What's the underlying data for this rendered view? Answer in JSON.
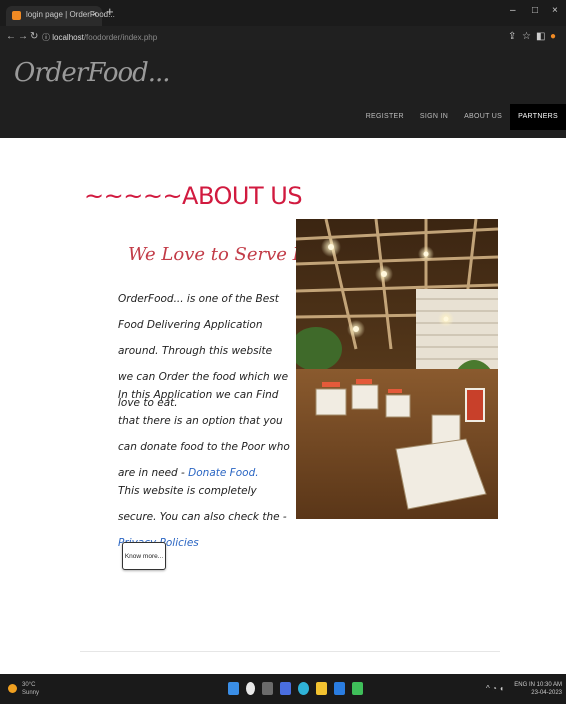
{
  "browser": {
    "tab_title": "login page | OrderFood...",
    "tab_close": "×",
    "new_tab": "+",
    "url_host": "localhost",
    "url_path": "/foodorder/index.php",
    "minimize": "–",
    "maximize": "□",
    "close": "×"
  },
  "site": {
    "logo": "OrderFood...",
    "nav": [
      {
        "label": "REGISTER"
      },
      {
        "label": "SIGN IN"
      },
      {
        "label": "ABOUT US"
      },
      {
        "label": "PARTNERS"
      }
    ]
  },
  "about": {
    "title": "~~~~~ABOUT US",
    "subheading": "We Love to Serve Best...",
    "p1": "OrderFood... is one of the Best Food Delivering Application around. Through this website we can Order the food which we love to eat.",
    "p2_text": "In this Application we can Find that there is an option that you can donate food to the Poor who are in need - ",
    "p2_link": "Donate Food.",
    "p3_text": "This website is completely secure. You can also check the - ",
    "p3_link": "Privacy Policies",
    "button": "Know more..."
  },
  "taskbar": {
    "weather_temp": "30°C",
    "weather_desc": "Sunny",
    "lang": "ENG IN",
    "time": "10:30 AM",
    "date": "23-04-2023"
  },
  "colors": {
    "accent_red": "#d11a3f",
    "link_blue": "#2b66c3",
    "header_bg": "#1f1f1f"
  }
}
